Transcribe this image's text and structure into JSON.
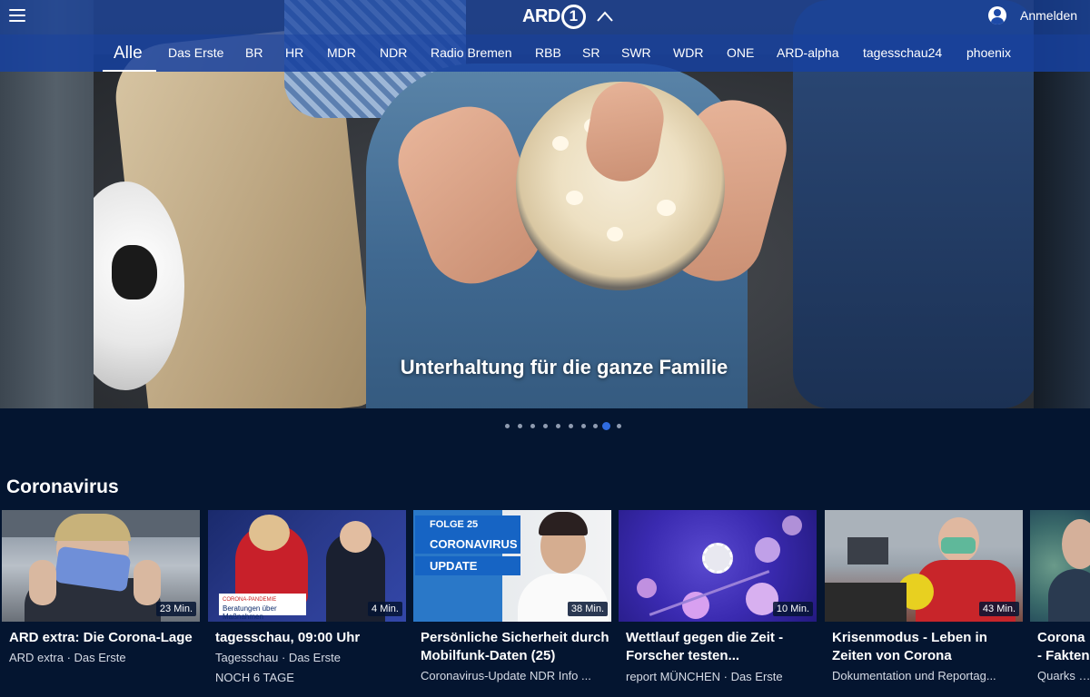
{
  "header": {
    "logo_text": "ARD",
    "logo_number": "1",
    "account_label": "Anmelden"
  },
  "nav": {
    "items": [
      {
        "label": "Alle",
        "active": true
      },
      {
        "label": "Das Erste"
      },
      {
        "label": "BR"
      },
      {
        "label": "HR"
      },
      {
        "label": "MDR"
      },
      {
        "label": "NDR"
      },
      {
        "label": "Radio Bremen"
      },
      {
        "label": "RBB"
      },
      {
        "label": "SR"
      },
      {
        "label": "SWR"
      },
      {
        "label": "WDR"
      },
      {
        "label": "ONE"
      },
      {
        "label": "ARD-alpha"
      },
      {
        "label": "tagesschau24"
      },
      {
        "label": "phoenix"
      }
    ]
  },
  "hero": {
    "caption": "Unterhaltung für die ganze Familie",
    "slide_count": 10,
    "active_slide": 9
  },
  "section": {
    "title": "Coronavirus",
    "cards": [
      {
        "title": "ARD extra: Die Corona-Lage",
        "subtitle": "ARD extra · Das Erste",
        "extra": "",
        "duration": "23 Min."
      },
      {
        "title": "tagesschau, 09:00 Uhr",
        "subtitle": "Tagesschau · Das Erste",
        "extra": "NOCH 6 TAGE",
        "duration": "4 Min."
      },
      {
        "title": "Persönliche Sicherheit durch Mobilfunk-Daten (25)",
        "subtitle": "Coronavirus-Update NDR Info ...",
        "extra": "",
        "duration": "38 Min."
      },
      {
        "title": "Wettlauf gegen die Zeit - Forscher testen...",
        "subtitle": "report MÜNCHEN · Das Erste",
        "extra": "",
        "duration": "10 Min."
      },
      {
        "title": "Krisenmodus - Leben in Zeiten von Corona",
        "subtitle": "Dokumentation und Reportag...",
        "extra": "",
        "duration": "43 Min."
      },
      {
        "title": "Corona - Fakten",
        "subtitle": "Quarks · W",
        "extra": "",
        "duration": ""
      }
    ]
  },
  "thumbs": {
    "folge": [
      "FOLGE 25",
      "CORONAVIRUS",
      "UPDATE"
    ],
    "news_lower": [
      "CORONA-PANDEMIE",
      "Beratungen über",
      "Maßnahmen"
    ]
  }
}
